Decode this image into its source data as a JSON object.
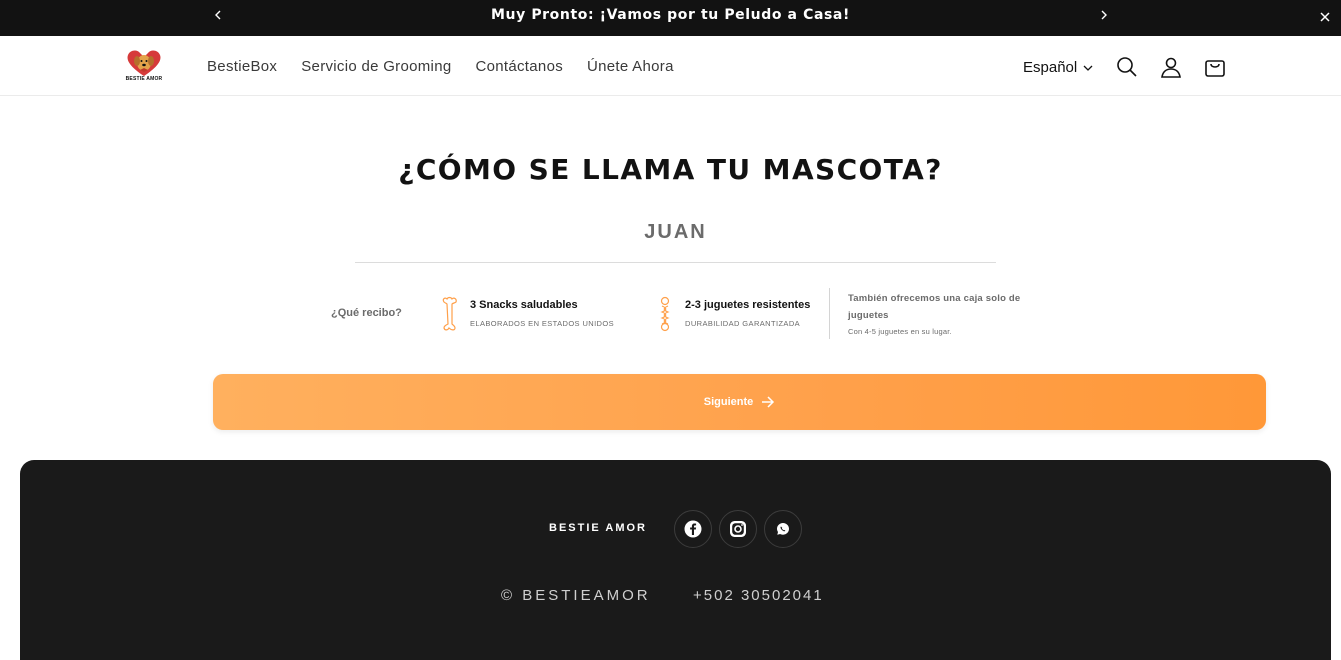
{
  "announcement": {
    "text": "Muy Pronto: ¡Vamos por tu Peludo a Casa!"
  },
  "header": {
    "logo_text": "BESTIE AMOR",
    "nav": [
      "BestieBox",
      "Servicio de Grooming",
      "Contáctanos",
      "Únete Ahora"
    ],
    "language": "Español"
  },
  "form": {
    "question": "¿CÓMO SE LLAMA TU MASCOTA?",
    "pet_name_value": "JUAN",
    "receive_label": "¿Qué recibo?",
    "items": [
      {
        "title": "3 Snacks saludables",
        "subtitle": "ELABORADOS EN ESTADOS UNIDOS",
        "icon": "bone-icon"
      },
      {
        "title": "2-3 juguetes resistentes",
        "subtitle": "DURABILIDAD GARANTIZADA",
        "icon": "rope-toy-icon"
      }
    ],
    "also_title": "También ofrecemos una caja solo de juguetes",
    "also_subtitle": "Con 4-5 juguetes en su lugar.",
    "next_label": "Siguiente"
  },
  "footer": {
    "brand": "BESTIE AMOR",
    "social": [
      "facebook-icon",
      "instagram-icon",
      "whatsapp-icon"
    ],
    "copyright": "© BESTIEAMOR",
    "phone": "+502 30502041"
  },
  "colors": {
    "accent": "#ffa04a",
    "dark": "#121212",
    "footer": "#1a1a1a"
  }
}
